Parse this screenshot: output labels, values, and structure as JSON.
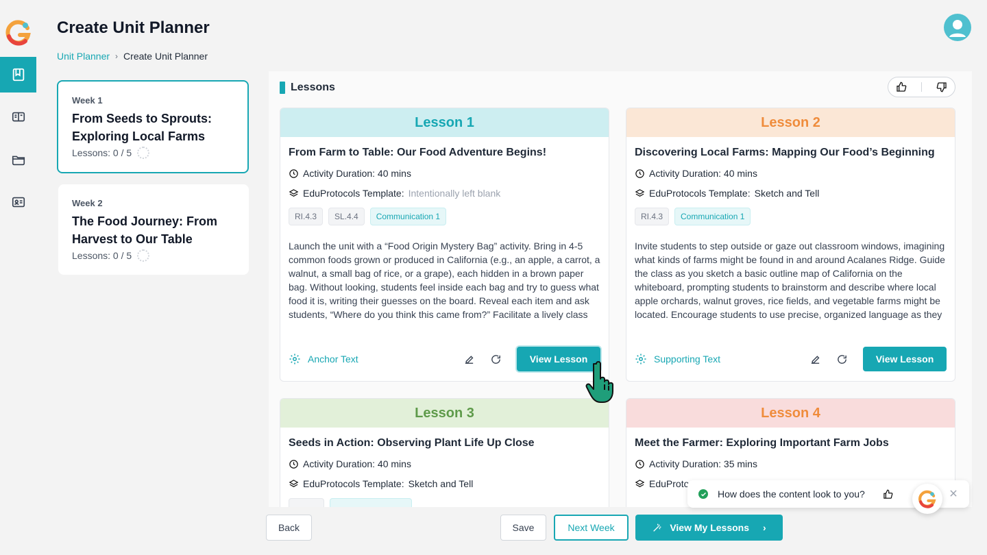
{
  "header": {
    "title": "Create Unit Planner",
    "breadcrumb": {
      "parent": "Unit Planner",
      "separator": "›",
      "current": "Create Unit Planner"
    }
  },
  "rail": {
    "items": [
      {
        "icon": "book-icon",
        "active": true
      },
      {
        "icon": "open-book-icon",
        "active": false
      },
      {
        "icon": "folder-icon",
        "active": false
      },
      {
        "icon": "id-card-icon",
        "active": false
      }
    ]
  },
  "weeks": [
    {
      "label": "Week 1",
      "title": "From Seeds to Sprouts: Exploring Local Farms",
      "lessons": "Lessons: 0 / 5",
      "active": true
    },
    {
      "label": "Week 2",
      "title": "The Food Journey: From Harvest to Our Table",
      "lessons": "Lessons: 0 / 5",
      "active": false
    }
  ],
  "panel": {
    "heading": "Lessons"
  },
  "lessons": [
    {
      "header": "Lesson 1",
      "header_bg": "#cdeef1",
      "header_color": "#17a7b3",
      "title": "From Farm to Table: Our Food Adventure Begins!",
      "duration": "Activity Duration: 40 mins",
      "template_label": "EduProtocols Template:",
      "template_value": "Intentionally left blank",
      "tags": [
        "RI.4.3",
        "SL.4.4",
        "Communication 1"
      ],
      "description": "Launch the unit with a “Food Origin Mystery Bag” activity. Bring in 4-5 common foods grown or produced in California (e.g., an apple, a carrot, a walnut, a small bag of rice, or a grape), each hidden in a brown paper bag. Without looking, students feel inside each bag and try to guess what food it is, writing their guesses on the board. Reveal each item and ask students, “Where do you think this came from?” Facilitate a lively class discussion about where and how",
      "text_type": "Anchor Text",
      "button": "View Lesson"
    },
    {
      "header": "Lesson 2",
      "header_bg": "#fbe7d6",
      "header_color": "#ef8c3c",
      "title": "Discovering Local Farms: Mapping Our Food’s Beginning",
      "duration": "Activity Duration: 40 mins",
      "template_label": "EduProtocols Template:",
      "template_value": "Sketch and Tell",
      "tags": [
        "RI.4.3",
        "Communication 1"
      ],
      "description": "Invite students to step outside or gaze out classroom windows, imagining what kinds of farms might be found in and around Acalanes Ridge. Guide the class as you sketch a basic outline map of California on the whiteboard, prompting students to brainstorm and describe where local apple orchards, walnut groves, rice fields, and vegetable farms might be located. Encourage students to use precise, organized language as they explain their thinking,",
      "text_type": "Supporting Text",
      "button": "View Lesson"
    },
    {
      "header": "Lesson 3",
      "header_bg": "#e2f0d9",
      "header_color": "#5e9a4a",
      "title": "Seeds in Action: Observing Plant Life Up Close",
      "duration": "Activity Duration: 40 mins",
      "template_label": "EduProtocols Template:",
      "template_value": "Sketch and Tell"
    },
    {
      "header": "Lesson 4",
      "header_bg": "#f9dcdc",
      "header_color": "#ef8c3c",
      "title": "Meet the Farmer: Exploring Important Farm Jobs",
      "duration": "Activity Duration: 35 mins",
      "template_label": "EduProto"
    }
  ],
  "footer": {
    "back": "Back",
    "save": "Save",
    "next_week": "Next Week",
    "view_my_lessons": "View My Lessons"
  },
  "toast": {
    "message": "How does the content look to you?"
  },
  "colors": {
    "accent": "#17a7b3",
    "success": "#22a05a"
  }
}
